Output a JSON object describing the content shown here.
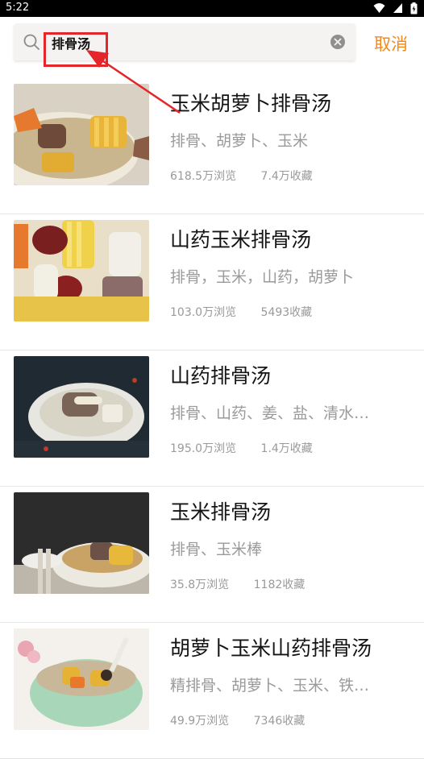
{
  "status_bar": {
    "time": "5:22",
    "icons": [
      "wifi-icon",
      "signal-icon",
      "battery-icon"
    ]
  },
  "search": {
    "query": "排骨汤",
    "cancel_label": "取消",
    "accent_color": "#f08a1d"
  },
  "annotation": {
    "color": "#e4262a"
  },
  "results": [
    {
      "title": "玉米胡萝卜排骨汤",
      "ingredients": "排骨、胡萝卜、玉米",
      "views": "618.5万浏览",
      "favorites": "7.4万收藏"
    },
    {
      "title": "山药玉米排骨汤",
      "ingredients": "排骨，玉米，山药，胡萝卜",
      "views": "103.0万浏览",
      "favorites": "5493收藏"
    },
    {
      "title": "山药排骨汤",
      "ingredients": "排骨、山药、姜、盐、清水…",
      "views": "195.0万浏览",
      "favorites": "1.4万收藏"
    },
    {
      "title": "玉米排骨汤",
      "ingredients": "排骨、玉米棒",
      "views": "35.8万浏览",
      "favorites": "1182收藏"
    },
    {
      "title": "胡萝卜玉米山药排骨汤",
      "ingredients": "精排骨、胡萝卜、玉米、铁…",
      "views": "49.9万浏览",
      "favorites": "7346收藏"
    }
  ]
}
